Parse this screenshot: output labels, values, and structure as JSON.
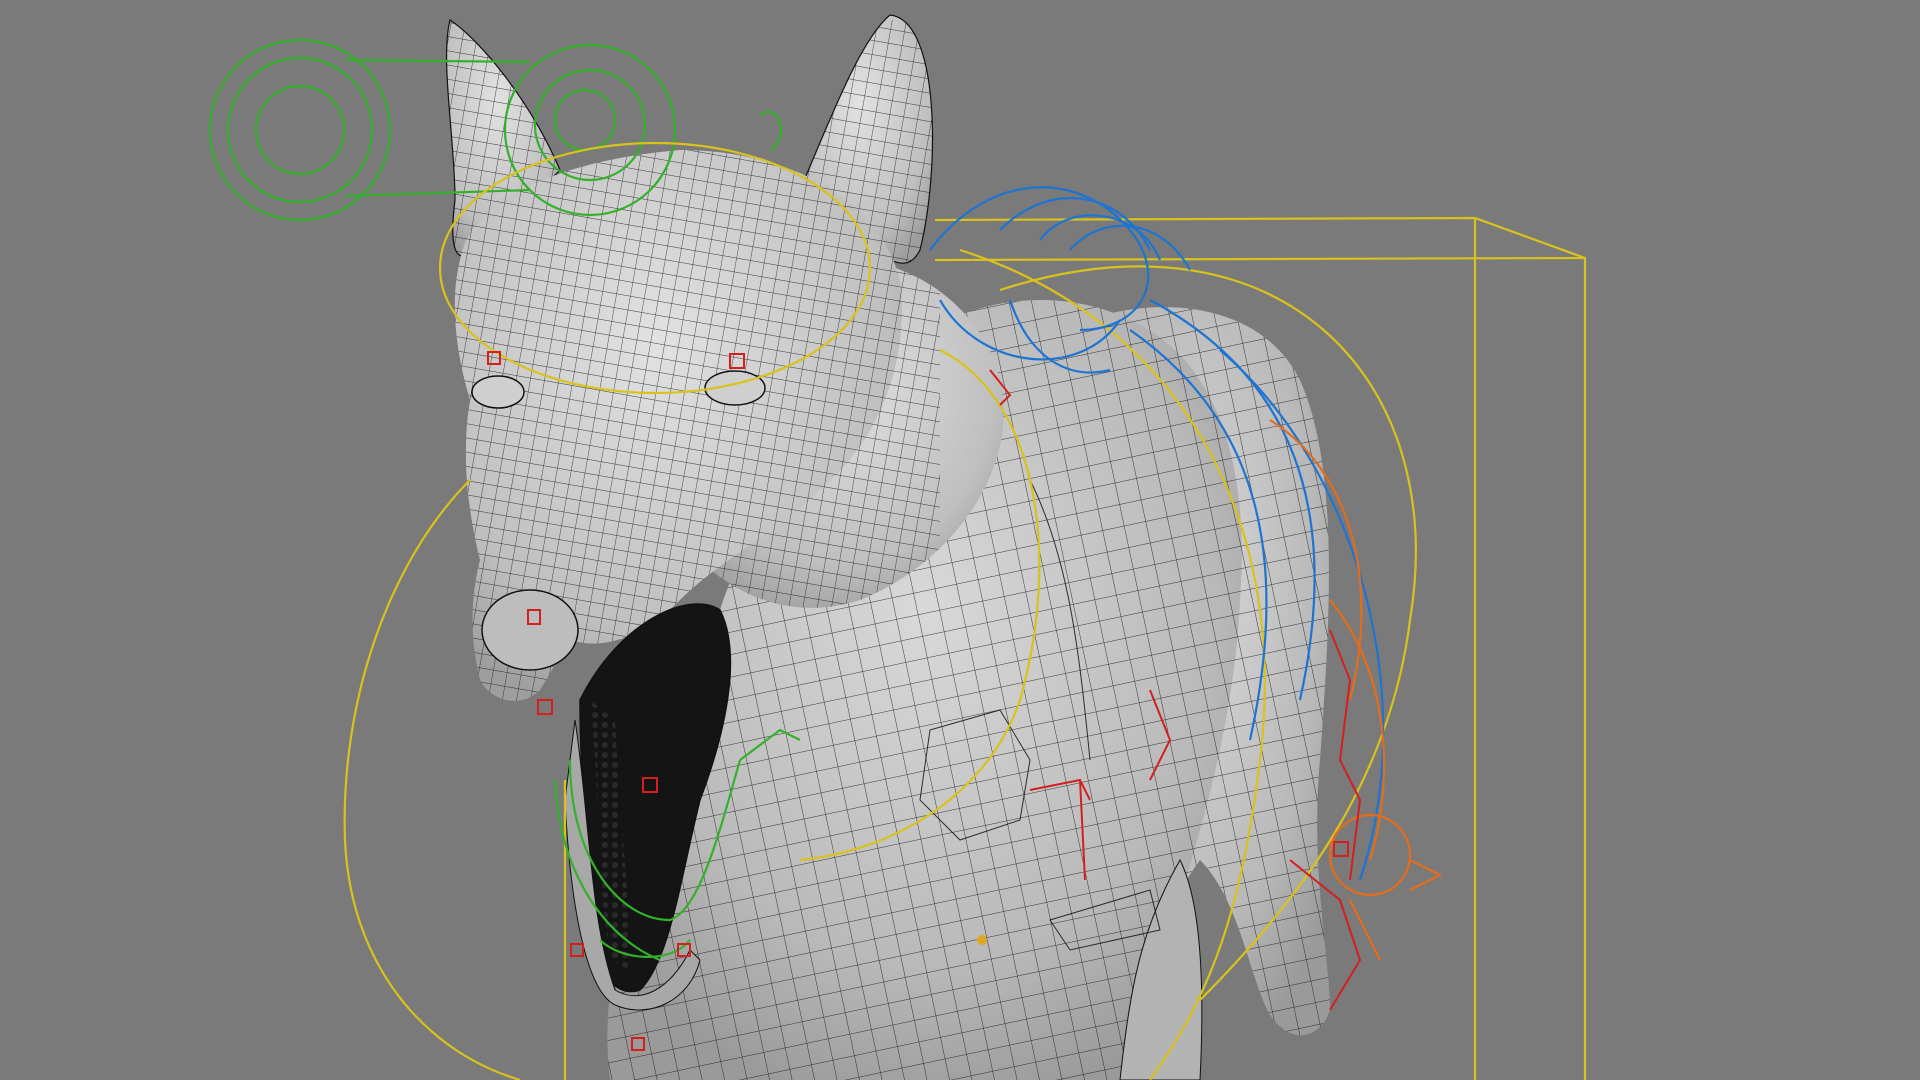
{
  "viewport": {
    "label": "",
    "background": "#7a7a7a"
  },
  "scene": {
    "subject": "dog-model",
    "display_mode": "wireframe-on-shaded"
  },
  "colors": {
    "mesh_fill": "#bdbdbd",
    "wire": "#111111",
    "control_yellow": "#d8c21c",
    "control_green": "#33b12a",
    "control_blue": "#1f74d1",
    "control_orange": "#e36d1b",
    "control_red": "#d3201f",
    "mouth_dark": "#141414"
  },
  "controls": [
    {
      "name": "head-eye-control",
      "color": "green"
    },
    {
      "name": "head-control",
      "color": "yellow"
    },
    {
      "name": "neck-control",
      "color": "yellow"
    },
    {
      "name": "body-control",
      "color": "yellow"
    },
    {
      "name": "spine-controls",
      "color": "blue"
    },
    {
      "name": "tail-controls",
      "color": "orange"
    },
    {
      "name": "jaw-control",
      "color": "green"
    },
    {
      "name": "face-controls",
      "color": "red"
    }
  ]
}
